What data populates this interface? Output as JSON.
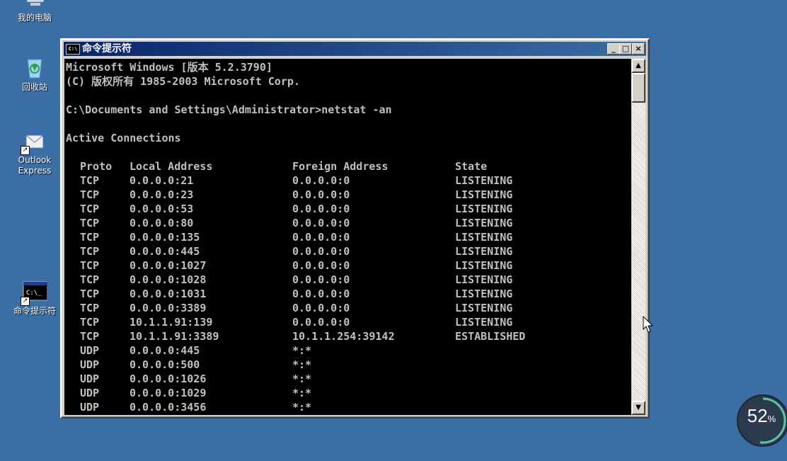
{
  "desktop": {
    "icons": [
      {
        "label": "我的电脑"
      },
      {
        "label": "回收站"
      },
      {
        "label": "Outlook\nExpress"
      },
      {
        "label": "命令提示符"
      }
    ]
  },
  "window": {
    "title": "命令提示符",
    "icon_text": "C:\\",
    "controls": {
      "minimize": "_",
      "maximize": "□",
      "close": "×"
    }
  },
  "console": {
    "banner_line1": "Microsoft Windows [版本 5.2.3790]",
    "banner_line2": "(C) 版权所有 1985-2003 Microsoft Corp.",
    "prompt": "C:\\Documents and Settings\\Administrator>netstat -an",
    "section_title": "Active Connections",
    "headers": {
      "proto": "Proto",
      "local": "Local Address",
      "foreign": "Foreign Address",
      "state": "State"
    },
    "rows": [
      {
        "proto": "TCP",
        "local": "0.0.0.0:21",
        "foreign": "0.0.0.0:0",
        "state": "LISTENING"
      },
      {
        "proto": "TCP",
        "local": "0.0.0.0:23",
        "foreign": "0.0.0.0:0",
        "state": "LISTENING"
      },
      {
        "proto": "TCP",
        "local": "0.0.0.0:53",
        "foreign": "0.0.0.0:0",
        "state": "LISTENING"
      },
      {
        "proto": "TCP",
        "local": "0.0.0.0:80",
        "foreign": "0.0.0.0:0",
        "state": "LISTENING"
      },
      {
        "proto": "TCP",
        "local": "0.0.0.0:135",
        "foreign": "0.0.0.0:0",
        "state": "LISTENING"
      },
      {
        "proto": "TCP",
        "local": "0.0.0.0:445",
        "foreign": "0.0.0.0:0",
        "state": "LISTENING"
      },
      {
        "proto": "TCP",
        "local": "0.0.0.0:1027",
        "foreign": "0.0.0.0:0",
        "state": "LISTENING"
      },
      {
        "proto": "TCP",
        "local": "0.0.0.0:1028",
        "foreign": "0.0.0.0:0",
        "state": "LISTENING"
      },
      {
        "proto": "TCP",
        "local": "0.0.0.0:1031",
        "foreign": "0.0.0.0:0",
        "state": "LISTENING"
      },
      {
        "proto": "TCP",
        "local": "0.0.0.0:3389",
        "foreign": "0.0.0.0:0",
        "state": "LISTENING"
      },
      {
        "proto": "TCP",
        "local": "10.1.1.91:139",
        "foreign": "0.0.0.0:0",
        "state": "LISTENING"
      },
      {
        "proto": "TCP",
        "local": "10.1.1.91:3389",
        "foreign": "10.1.1.254:39142",
        "state": "ESTABLISHED"
      },
      {
        "proto": "UDP",
        "local": "0.0.0.0:445",
        "foreign": "*:*",
        "state": ""
      },
      {
        "proto": "UDP",
        "local": "0.0.0.0:500",
        "foreign": "*:*",
        "state": ""
      },
      {
        "proto": "UDP",
        "local": "0.0.0.0:1026",
        "foreign": "*:*",
        "state": ""
      },
      {
        "proto": "UDP",
        "local": "0.0.0.0:1029",
        "foreign": "*:*",
        "state": ""
      },
      {
        "proto": "UDP",
        "local": "0.0.0.0:3456",
        "foreign": "*:*",
        "state": ""
      }
    ]
  },
  "gauge": {
    "value": 52,
    "unit": "%",
    "color": "#5cc7a0"
  }
}
